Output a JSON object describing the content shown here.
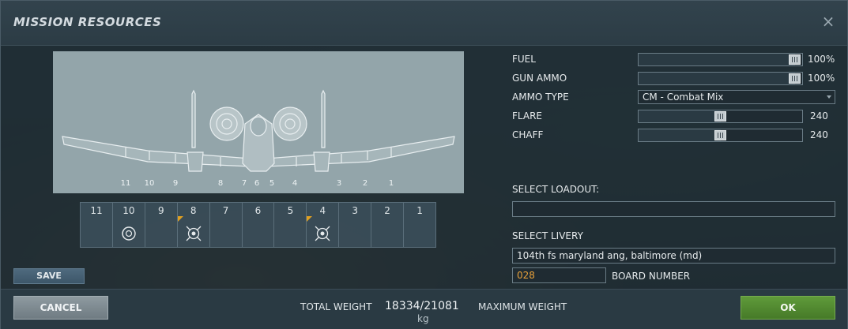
{
  "window": {
    "title": "MISSION RESOURCES",
    "close_glyph": "×"
  },
  "preview": {
    "station_labels": [
      "11",
      "10",
      "9",
      "8",
      "7",
      "6",
      "5",
      "4",
      "3",
      "2",
      "1"
    ]
  },
  "pylons": [
    {
      "number": "11",
      "store_icon": "",
      "flag": false
    },
    {
      "number": "10",
      "store_icon": "pod-icon",
      "flag": false
    },
    {
      "number": "9",
      "store_icon": "",
      "flag": false
    },
    {
      "number": "8",
      "store_icon": "munition-icon",
      "flag": true
    },
    {
      "number": "7",
      "store_icon": "",
      "flag": false
    },
    {
      "number": "6",
      "store_icon": "",
      "flag": false
    },
    {
      "number": "5",
      "store_icon": "",
      "flag": false
    },
    {
      "number": "4",
      "store_icon": "munition-icon",
      "flag": true
    },
    {
      "number": "3",
      "store_icon": "",
      "flag": false
    },
    {
      "number": "2",
      "store_icon": "",
      "flag": false
    },
    {
      "number": "1",
      "store_icon": "",
      "flag": false
    }
  ],
  "resources": {
    "fuel": {
      "label": "FUEL",
      "value": "100%",
      "level": 1.0
    },
    "gun_ammo": {
      "label": "GUN AMMO",
      "value": "100%",
      "level": 1.0
    },
    "ammo_type": {
      "label": "AMMO TYPE",
      "selected": "CM - Combat Mix"
    },
    "flare": {
      "label": "FLARE",
      "value": "240",
      "level": 0.5
    },
    "chaff": {
      "label": "CHAFF",
      "value": "240",
      "level": 0.5
    }
  },
  "loadout": {
    "label": "SELECT LOADOUT:",
    "value": ""
  },
  "livery": {
    "label": "SELECT LIVERY",
    "value": "104th fs maryland ang, baltimore (md)"
  },
  "board_number": {
    "value": "028",
    "label": "BOARD NUMBER"
  },
  "buttons": {
    "save": "SAVE",
    "cancel": "CANCEL",
    "ok": "OK"
  },
  "weight": {
    "total_label": "TOTAL WEIGHT",
    "value": "18334/21081",
    "unit": "kg",
    "max_label": "MAXIMUM WEIGHT"
  },
  "colors": {
    "ok_button": "#5f9a3a",
    "board_number_text": "#e8a13a",
    "store_flag": "#e0a020"
  }
}
